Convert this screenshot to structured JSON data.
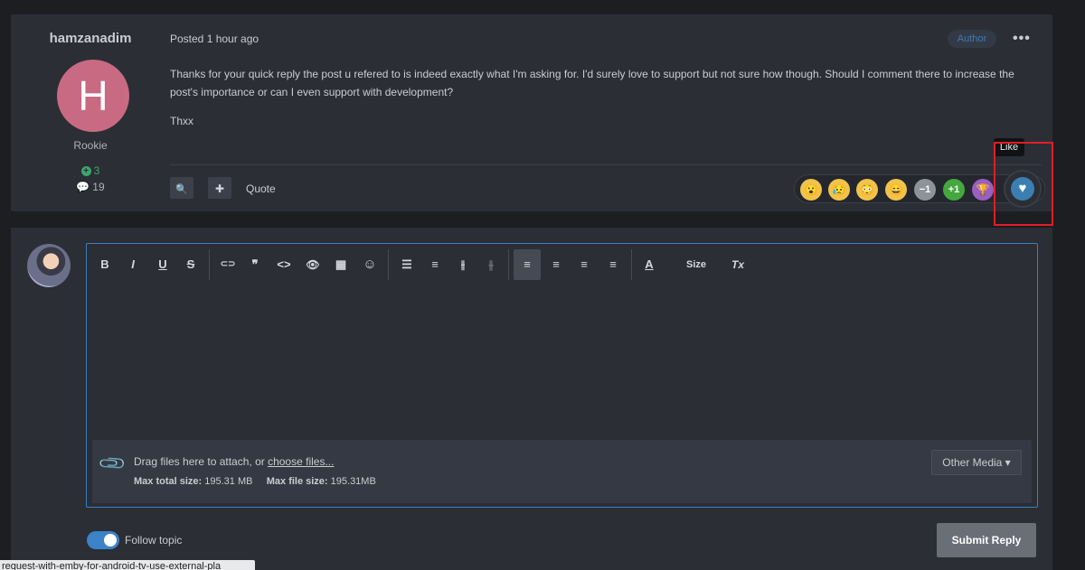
{
  "post": {
    "author": "hamzanadim",
    "avatar_letter": "H",
    "rank": "Rookie",
    "reputation": "3",
    "message_count": "19",
    "posted": "Posted 1 hour ago",
    "author_badge": "Author",
    "more_label": "•••",
    "body": [
      "Thanks for your quick reply the post u refered to is indeed exactly what I'm asking for. I'd surely love to support but not sure how though. Should I comment there to increase the post's importance or can I even support with development?",
      "Thxx"
    ],
    "search_icon": "🔍",
    "plus_icon": "✚",
    "quote_label": "Quote",
    "reactions": [
      {
        "name": "surprised",
        "glyph": "😮"
      },
      {
        "name": "sad",
        "glyph": "😥"
      },
      {
        "name": "shocked",
        "glyph": "😳"
      },
      {
        "name": "laugh",
        "glyph": "😄"
      },
      {
        "name": "minus-one",
        "glyph": "−1"
      },
      {
        "name": "plus-one",
        "glyph": "+1"
      },
      {
        "name": "trophy",
        "glyph": "🏆"
      }
    ],
    "like_tooltip": "Like",
    "like_icon": "♥"
  },
  "editor": {
    "toolbar": [
      "B",
      "I",
      "U",
      "S",
      "⊂⊃",
      "❞",
      "<>",
      "👁",
      "▦",
      "☺",
      "☰",
      "≡",
      "⫲",
      "⫳",
      "≡",
      "≡",
      "≡",
      "≡",
      "A",
      "Size",
      "Tx"
    ],
    "attach_text": "Drag files here to attach, or ",
    "attach_link": "choose files...",
    "max_total_label": "Max total size:",
    "max_total_value": "195.31 MB",
    "max_file_label": "Max file size:",
    "max_file_value": "195.31MB",
    "other_media": "Other Media ▾"
  },
  "footer": {
    "follow_label": "Follow topic",
    "follow_on": true,
    "submit_label": "Submit Reply"
  },
  "status_bar": "request-with-emby-for-android-tv-use-external-pla"
}
